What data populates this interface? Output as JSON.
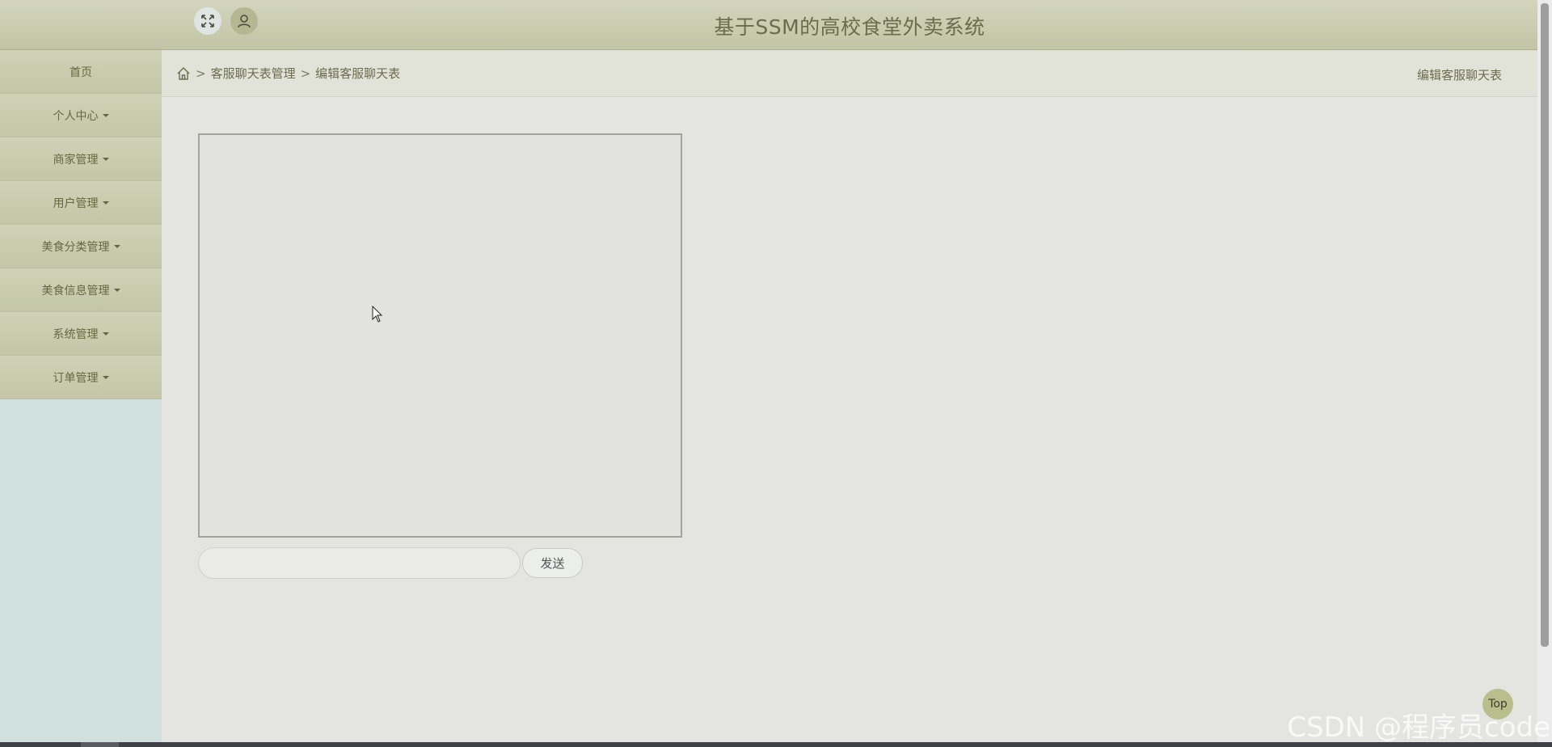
{
  "header": {
    "title": "基于SSM的高校食堂外卖系统",
    "icons": {
      "fullscreen": "fullscreen-icon",
      "user": "user-icon"
    }
  },
  "sidebar": {
    "items": [
      {
        "label": "首页",
        "has_caret": false
      },
      {
        "label": "个人中心",
        "has_caret": true
      },
      {
        "label": "商家管理",
        "has_caret": true
      },
      {
        "label": "用户管理",
        "has_caret": true
      },
      {
        "label": "美食分类管理",
        "has_caret": true
      },
      {
        "label": "美食信息管理",
        "has_caret": true
      },
      {
        "label": "系统管理",
        "has_caret": true
      },
      {
        "label": "订单管理",
        "has_caret": true
      }
    ]
  },
  "breadcrumb": {
    "home_icon": "home-icon",
    "separator": ">",
    "items": [
      "客服聊天表管理",
      "编辑客服聊天表"
    ],
    "right_title": "编辑客服聊天表"
  },
  "chat": {
    "input_value": "",
    "input_placeholder": "",
    "send_label": "发送"
  },
  "top_button": {
    "label": "Top"
  },
  "watermark": "CSDN @程序员code",
  "colors": {
    "header_bg": "#c8cbad",
    "sidebar_item_bg": "#c9ccae",
    "sidebar_bg": "#d0e0dd",
    "page_bg": "#e4e5e1",
    "text": "#65683f"
  }
}
